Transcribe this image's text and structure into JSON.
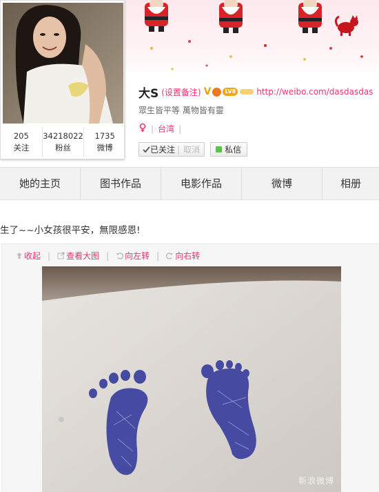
{
  "profile": {
    "name": "大S",
    "remark_link": "(设置备注)",
    "badge_v": "V",
    "level_badge": "LV8",
    "homepage": "http://weibo.com/dasdasdas",
    "motto": "眾生皆平等 萬物皆有靈",
    "location": "台湾",
    "stats": [
      {
        "value": "205",
        "label": "关注"
      },
      {
        "value": "34218022",
        "label": "粉丝"
      },
      {
        "value": "1735",
        "label": "微博"
      }
    ],
    "followed_label": "已关注",
    "cancel_label": "取消",
    "dm_label": "私信"
  },
  "tabs": [
    {
      "label": "她的主页"
    },
    {
      "label": "图书作品"
    },
    {
      "label": "电影作品"
    },
    {
      "label": "微博"
    },
    {
      "label": "相册"
    }
  ],
  "post": {
    "text": "生了~~小女孩很平安，無限感恩!",
    "tools": [
      {
        "label": "收起",
        "icon": "arrow-up-icon"
      },
      {
        "label": "查看大图",
        "icon": "external-link-icon"
      },
      {
        "label": "向左转",
        "icon": "rotate-left-icon"
      },
      {
        "label": "向右转",
        "icon": "rotate-right-icon"
      }
    ],
    "watermark": "新浪微博"
  },
  "colors": {
    "accent_pink": "#e8336f",
    "tab_bg": "#f2f2f2",
    "stamp_blue": "#3a3f9e"
  }
}
